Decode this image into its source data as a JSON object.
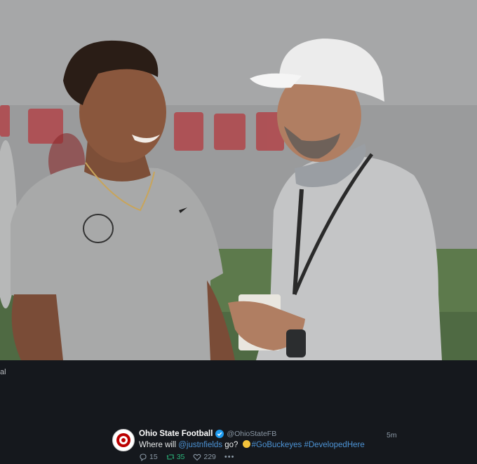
{
  "photo": {
    "alt_subject": "photo"
  },
  "edge_text": "al",
  "tweet": {
    "display_name": "Ohio State Football",
    "handle": "@OhioStateFB",
    "time": "5m",
    "text_prefix": "Where will ",
    "mention": "@justnfields",
    "text_middle": " go? ",
    "hashtag1": "#GoBuckeyes",
    "hashtag2": "#DevelopedHere",
    "replies": "15",
    "retweets": "35",
    "likes": "229",
    "more": "•••"
  },
  "colors": {
    "background": "#15181d",
    "link": "#4d94d6",
    "retweet_active": "#2bb57a",
    "muted": "#8b98a5"
  }
}
